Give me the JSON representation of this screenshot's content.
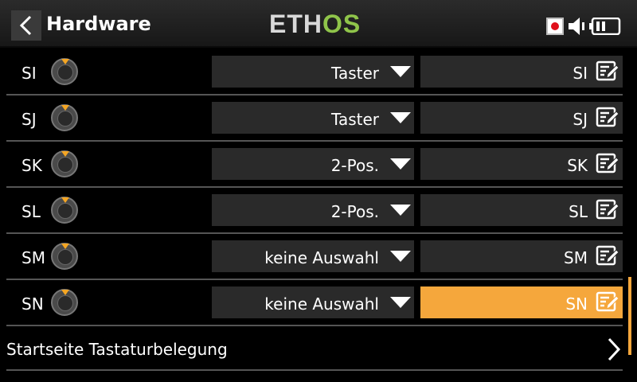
{
  "header": {
    "title": "Hardware",
    "logo_eth": "ETH",
    "logo_os": "OS"
  },
  "rows": [
    {
      "label": "SI",
      "type": "Taster",
      "name": "SI",
      "active": false
    },
    {
      "label": "SJ",
      "type": "Taster",
      "name": "SJ",
      "active": false
    },
    {
      "label": "SK",
      "type": "2-Pos.",
      "name": "SK",
      "active": false
    },
    {
      "label": "SL",
      "type": "2-Pos.",
      "name": "SL",
      "active": false
    },
    {
      "label": "SM",
      "type": "keine Auswahl",
      "name": "SM",
      "active": false
    },
    {
      "label": "SN",
      "type": "keine Auswahl",
      "name": "SN",
      "active": true
    }
  ],
  "nav": {
    "label": "Startseite Tastaturbelegung"
  },
  "colors": {
    "accent": "#f5a73c",
    "logo_green": "#8fc44a",
    "record_red": "#e0101b"
  },
  "icons": [
    "back-arrow-icon",
    "record-icon",
    "speaker-icon",
    "battery-icon",
    "switch-knob-icon",
    "dropdown-arrow-icon",
    "edit-icon",
    "chevron-right-icon"
  ]
}
